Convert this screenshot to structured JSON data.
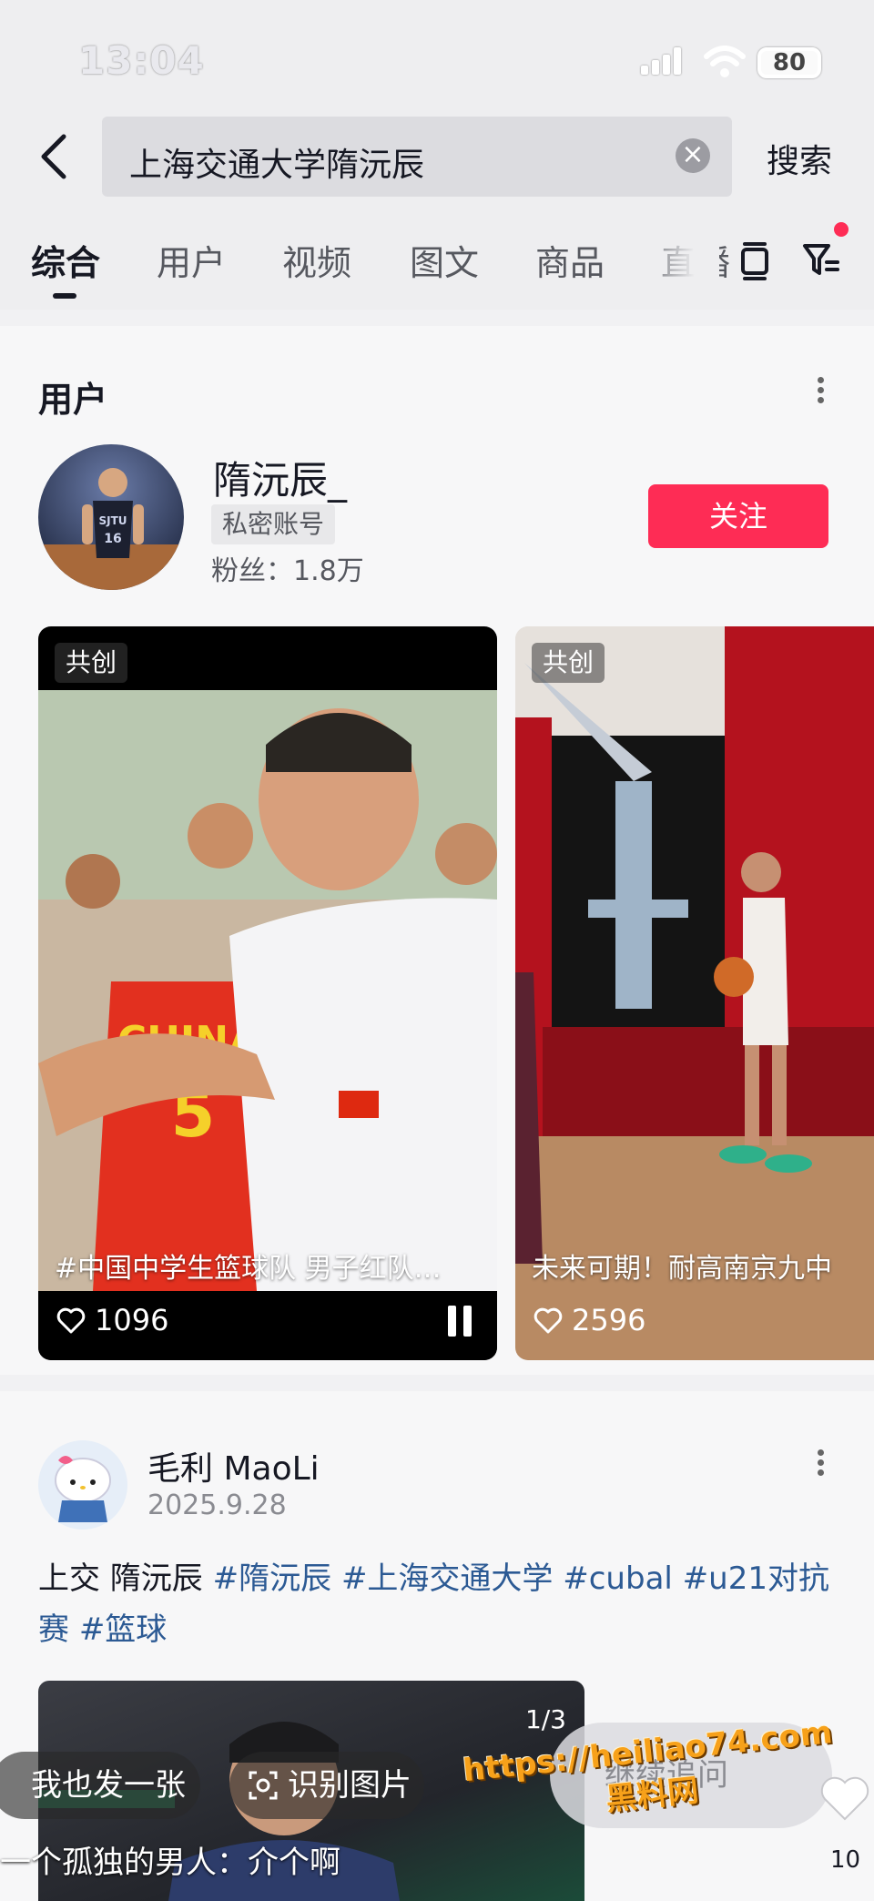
{
  "status_bar": {
    "time": "13:04",
    "battery": "80"
  },
  "search": {
    "query": "上海交通大学隋沅辰",
    "button_label": "搜索"
  },
  "tabs": [
    "综合",
    "用户",
    "视频",
    "图文",
    "商品",
    "直播"
  ],
  "active_tab": "综合",
  "user_section": {
    "title": "用户",
    "user": {
      "name": "隋沅辰_",
      "badge": "私密账号",
      "followers": "粉丝：1.8万",
      "jersey_text": "SJTU",
      "jersey_number": "16",
      "follow_label": "关注"
    },
    "videos": [
      {
        "tag": "共创",
        "caption": "#中国中学生篮球队 男子红队…",
        "likes": "1096",
        "jersey_text": "CHINA",
        "jersey_number": "5"
      },
      {
        "tag": "共创",
        "caption": "未来可期！耐高南京九中",
        "likes": "2596"
      }
    ]
  },
  "post": {
    "author": "毛利 MaoLi",
    "date": "2025.9.28",
    "text_plain": "上交 隋沅辰 ",
    "hashtags": [
      "#隋沅辰",
      "#上海交通大学",
      "#cubal",
      "#u21对抗赛",
      "#篮球"
    ],
    "image_count": "1/3",
    "bottom_caption": "一个孤独的男人：介个啊"
  },
  "overlay": {
    "chip_post": "我也发一张",
    "chip_recognize": "识别图片",
    "ask_label": "继续追问",
    "like_count": "10"
  },
  "watermark": {
    "url": "https://heiliao74.com",
    "name": "黑料网"
  },
  "colors": {
    "accent": "#fe2c55",
    "hashtag": "#2c5a94"
  }
}
